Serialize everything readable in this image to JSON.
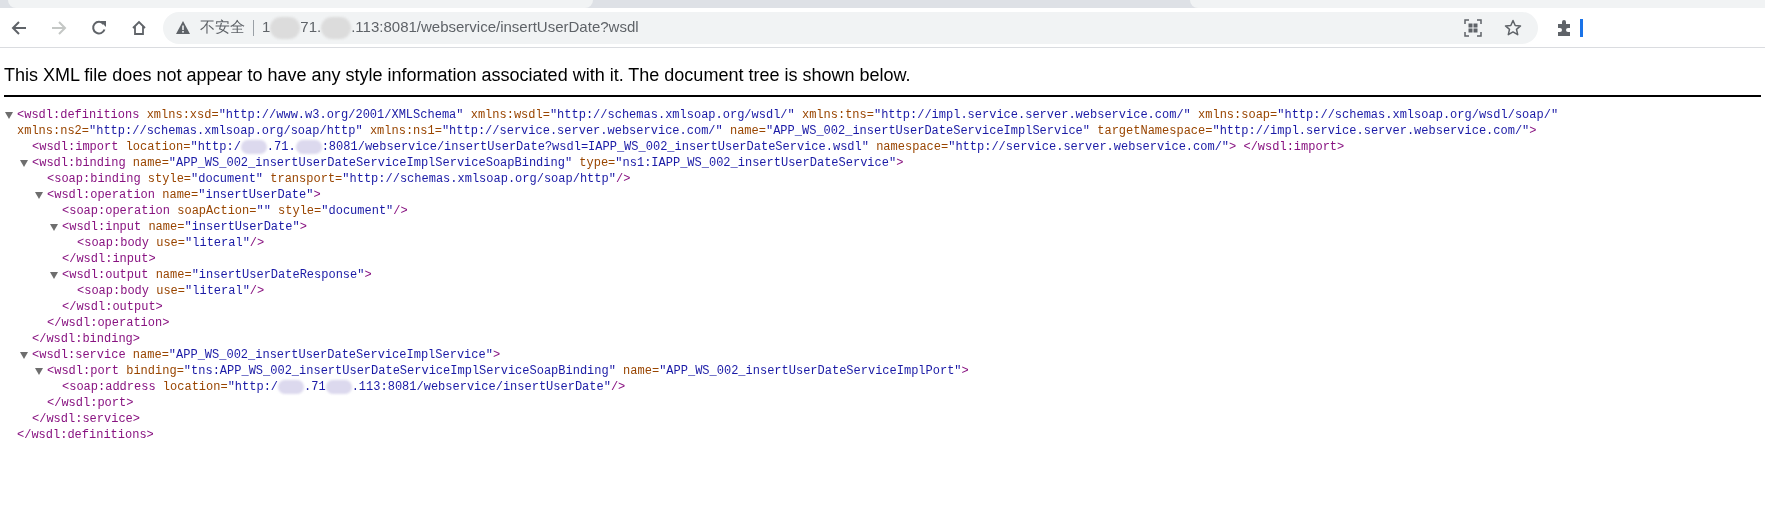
{
  "navigation": {
    "back_disabled": false,
    "forward_disabled": true
  },
  "address_bar": {
    "security_label": "不安全",
    "url": [
      {
        "kind": "text",
        "text": "1"
      },
      {
        "kind": "redacted"
      },
      {
        "kind": "text",
        "text": "71."
      },
      {
        "kind": "redacted"
      },
      {
        "kind": "text",
        "text": ".113:8081/webservice/insertUserDate?wsdl"
      }
    ]
  },
  "notice": "This XML file does not appear to have any style information associated with it. The document tree is shown below.",
  "tree": {
    "open": "<wsdl:definitions",
    "expanded": true,
    "attributes": [
      {
        "name": "xmlns:xsd=",
        "value": "\"http://www.w3.org/2001/XMLSchema\""
      },
      {
        "name": "xmlns:wsdl=",
        "value": "\"http://schemas.xmlsoap.org/wsdl/\""
      },
      {
        "name": "xmlns:tns=",
        "value": "\"http://impl.service.server.webservice.com/\""
      },
      {
        "name": "xmlns:soap=",
        "value": "\"http://schemas.xmlsoap.org/wsdl/soap/\""
      },
      {
        "name": "xmlns:ns2=",
        "value": "\"http://schemas.xmlsoap.org/soap/http\""
      },
      {
        "name": "xmlns:ns1=",
        "value": "\"http://service.server.webservice.com/\""
      },
      {
        "name": "name=",
        "value": "\"APP_WS_002_insertUserDateServiceImplService\""
      },
      {
        "name": "targetNamespace=",
        "value": "\"http://impl.service.server.webservice.com/\""
      }
    ],
    "end": ">",
    "close": "</wsdl:definitions>",
    "children": [
      {
        "open": "<wsdl:import",
        "attributes": [
          {
            "name": "location=",
            "value": [
              {
                "kind": "text",
                "text": "\"http:/"
              },
              {
                "kind": "redacted"
              },
              {
                "kind": "text",
                "text": ".71."
              },
              {
                "kind": "redacted"
              },
              {
                "kind": "text",
                "text": ":8081/webservice/insertUserDate?wsdl=IAPP_WS_002_insertUserDateService.wsdl\""
              }
            ]
          },
          {
            "name": "namespace=",
            "value": "\"http://service.server.webservice.com/\""
          }
        ],
        "end": ">",
        "close": "</wsdl:import>"
      },
      {
        "open": "<wsdl:binding",
        "expanded": true,
        "attributes": [
          {
            "name": "name=",
            "value": "\"APP_WS_002_insertUserDateServiceImplServiceSoapBinding\""
          },
          {
            "name": "type=",
            "value": "\"ns1:IAPP_WS_002_insertUserDateService\""
          }
        ],
        "end": ">",
        "close": "</wsdl:binding>",
        "children": [
          {
            "open": "<soap:binding",
            "attributes": [
              {
                "name": "style=",
                "value": "\"document\""
              },
              {
                "name": "transport=",
                "value": "\"http://schemas.xmlsoap.org/soap/http\""
              }
            ],
            "end": "/>"
          },
          {
            "open": "<wsdl:operation",
            "expanded": true,
            "attributes": [
              {
                "name": "name=",
                "value": "\"insertUserDate\""
              }
            ],
            "end": ">",
            "close": "</wsdl:operation>",
            "children": [
              {
                "open": "<soap:operation",
                "attributes": [
                  {
                    "name": "soapAction=",
                    "value": "\"\""
                  },
                  {
                    "name": "style=",
                    "value": "\"document\""
                  }
                ],
                "end": "/>"
              },
              {
                "open": "<wsdl:input",
                "expanded": true,
                "attributes": [
                  {
                    "name": "name=",
                    "value": "\"insertUserDate\""
                  }
                ],
                "end": ">",
                "close": "</wsdl:input>",
                "children": [
                  {
                    "open": "<soap:body",
                    "attributes": [
                      {
                        "name": "use=",
                        "value": "\"literal\""
                      }
                    ],
                    "end": "/>"
                  }
                ]
              },
              {
                "open": "<wsdl:output",
                "expanded": true,
                "attributes": [
                  {
                    "name": "name=",
                    "value": "\"insertUserDateResponse\""
                  }
                ],
                "end": ">",
                "close": "</wsdl:output>",
                "children": [
                  {
                    "open": "<soap:body",
                    "attributes": [
                      {
                        "name": "use=",
                        "value": "\"literal\""
                      }
                    ],
                    "end": "/>"
                  }
                ]
              }
            ]
          }
        ]
      },
      {
        "open": "<wsdl:service",
        "expanded": true,
        "attributes": [
          {
            "name": "name=",
            "value": "\"APP_WS_002_insertUserDateServiceImplService\""
          }
        ],
        "end": ">",
        "close": "</wsdl:service>",
        "children": [
          {
            "open": "<wsdl:port",
            "expanded": true,
            "attributes": [
              {
                "name": "binding=",
                "value": "\"tns:APP_WS_002_insertUserDateServiceImplServiceSoapBinding\""
              },
              {
                "name": "name=",
                "value": "\"APP_WS_002_insertUserDateServiceImplPort\""
              }
            ],
            "end": ">",
            "close": "</wsdl:port>",
            "children": [
              {
                "open": "<soap:address",
                "attributes": [
                  {
                    "name": "location=",
                    "value": [
                      {
                        "kind": "text",
                        "text": "\"http:/"
                      },
                      {
                        "kind": "redacted"
                      },
                      {
                        "kind": "text",
                        "text": ".71"
                      },
                      {
                        "kind": "redacted"
                      },
                      {
                        "kind": "text",
                        "text": ".113:8081/webservice/insertUserDate\""
                      }
                    ]
                  }
                ],
                "end": "/>"
              }
            ]
          }
        ]
      }
    ]
  }
}
